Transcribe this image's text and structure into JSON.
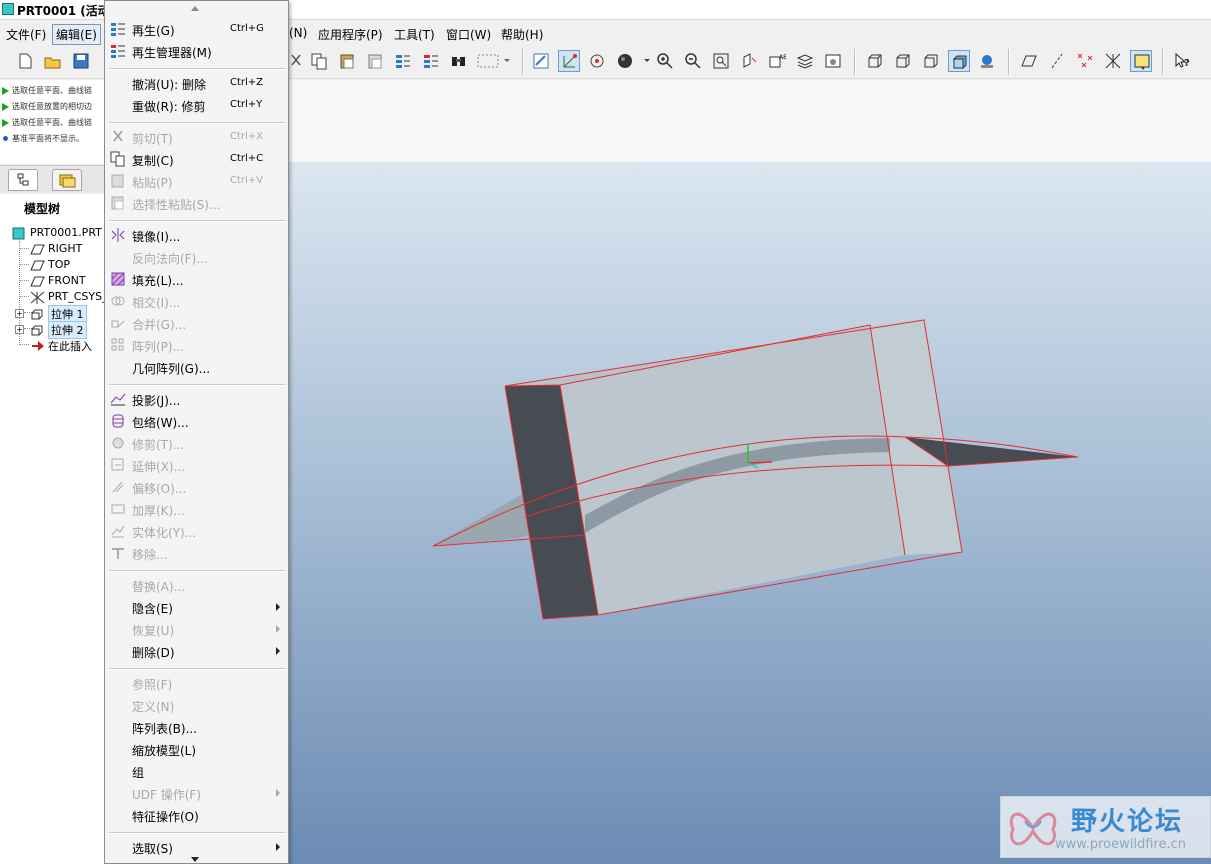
{
  "window": {
    "title": "PRT0001 (活动"
  },
  "menubar": {
    "items": [
      {
        "label": "文件(F)",
        "id": "file"
      },
      {
        "label": "编辑(E)",
        "id": "edit",
        "active": true
      },
      {
        "label": "(N)",
        "id": "insert"
      },
      {
        "label": "应用程序(P)",
        "id": "applications"
      },
      {
        "label": "工具(T)",
        "id": "tools"
      },
      {
        "label": "窗口(W)",
        "id": "window"
      },
      {
        "label": "帮助(H)",
        "id": "help"
      }
    ]
  },
  "toolbar": {
    "buttons": [
      "new-icon",
      "open-icon",
      "save-icon",
      "cut-icon",
      "copy-icon",
      "paste-icon",
      "paste-special-icon",
      "regenerate-icon",
      "regen-manager-icon",
      "find-icon",
      "select-box-icon",
      "repaint-icon",
      "spin-center-icon",
      "orient-icon",
      "shading-icon",
      "zoom-in-icon",
      "zoom-out-icon",
      "refit-icon",
      "reorient-icon",
      "saved-views-icon",
      "layers-icon",
      "view-manager-icon",
      "wireframe-icon",
      "hidden-line-icon",
      "no-hidden-icon",
      "shaded-icon",
      "enhanced-realism-icon",
      "datum-planes-icon",
      "datum-axes-icon",
      "datum-points-icon",
      "csys-icon",
      "annotations-icon",
      "context-help-icon"
    ]
  },
  "messages": [
    {
      "type": "arrow",
      "text": "选取任意平面、曲线链"
    },
    {
      "type": "arrow",
      "text": "选取任意放置的相切边"
    },
    {
      "type": "arrow",
      "text": "选取任意平面、曲线链"
    },
    {
      "type": "info",
      "text": "基准平面将不显示。"
    }
  ],
  "model_tree": {
    "header": "模型树",
    "root": "PRT0001.PRT",
    "items": [
      {
        "label": "RIGHT",
        "icon": "datum-plane-icon"
      },
      {
        "label": "TOP",
        "icon": "datum-plane-icon"
      },
      {
        "label": "FRONT",
        "icon": "datum-plane-icon"
      },
      {
        "label": "PRT_CSYS_",
        "icon": "csys-icon"
      },
      {
        "label": "拉伸 1",
        "icon": "extrude-icon",
        "expandable": true,
        "highlight": true
      },
      {
        "label": "拉伸 2",
        "icon": "extrude-icon",
        "expandable": true,
        "highlight": true
      },
      {
        "label": "在此插入",
        "icon": "insert-here-icon"
      }
    ]
  },
  "edit_menu": {
    "items": [
      {
        "label": "再生(G)",
        "shortcut": "Ctrl+G",
        "enabled": true,
        "icon": "regenerate-icon"
      },
      {
        "label": "再生管理器(M)",
        "shortcut": "",
        "enabled": true,
        "icon": "regen-manager-icon"
      },
      {
        "sep": true
      },
      {
        "label": "撤消(U): 删除",
        "shortcut": "Ctrl+Z",
        "enabled": true
      },
      {
        "label": "重做(R): 修剪",
        "shortcut": "Ctrl+Y",
        "enabled": true
      },
      {
        "sep": true
      },
      {
        "label": "剪切(T)",
        "shortcut": "Ctrl+X",
        "enabled": false,
        "icon": "cut-icon"
      },
      {
        "label": "复制(C)",
        "shortcut": "Ctrl+C",
        "enabled": true,
        "icon": "copy-icon"
      },
      {
        "label": "粘贴(P)",
        "shortcut": "Ctrl+V",
        "enabled": false,
        "icon": "paste-icon"
      },
      {
        "label": "选择性粘贴(S)...",
        "shortcut": "",
        "enabled": false,
        "icon": "paste-special-icon"
      },
      {
        "sep": true
      },
      {
        "label": "镜像(I)...",
        "shortcut": "",
        "enabled": true,
        "icon": "mirror-icon"
      },
      {
        "label": "反向法向(F)...",
        "shortcut": "",
        "enabled": false
      },
      {
        "label": "填充(L)...",
        "shortcut": "",
        "enabled": true,
        "icon": "fill-icon"
      },
      {
        "label": "相交(I)...",
        "shortcut": "",
        "enabled": false,
        "icon": "intersect-icon"
      },
      {
        "label": "合并(G)...",
        "shortcut": "",
        "enabled": false,
        "icon": "merge-icon"
      },
      {
        "label": "阵列(P)...",
        "shortcut": "",
        "enabled": false,
        "icon": "pattern-icon"
      },
      {
        "label": "几何阵列(G)...",
        "shortcut": "",
        "enabled": true
      },
      {
        "sep": true
      },
      {
        "label": "投影(J)...",
        "shortcut": "",
        "enabled": true,
        "icon": "project-icon"
      },
      {
        "label": "包络(W)...",
        "shortcut": "",
        "enabled": true,
        "icon": "wrap-icon"
      },
      {
        "label": "修剪(T)...",
        "shortcut": "",
        "enabled": false,
        "icon": "trim-icon"
      },
      {
        "label": "延伸(X)...",
        "shortcut": "",
        "enabled": false,
        "icon": "extend-icon"
      },
      {
        "label": "偏移(O)...",
        "shortcut": "",
        "enabled": false,
        "icon": "offset-icon"
      },
      {
        "label": "加厚(K)...",
        "shortcut": "",
        "enabled": false,
        "icon": "thicken-icon"
      },
      {
        "label": "实体化(Y)...",
        "shortcut": "",
        "enabled": false,
        "icon": "solidify-icon"
      },
      {
        "label": "移除...",
        "shortcut": "",
        "enabled": false,
        "icon": "remove-icon"
      },
      {
        "sep": true
      },
      {
        "label": "替换(A)...",
        "shortcut": "",
        "enabled": false
      },
      {
        "label": "隐含(E)",
        "shortcut": "",
        "enabled": true,
        "submenu": true
      },
      {
        "label": "恢复(U)",
        "shortcut": "",
        "enabled": false,
        "submenu": true
      },
      {
        "label": "删除(D)",
        "shortcut": "",
        "enabled": true,
        "submenu": true
      },
      {
        "sep": true
      },
      {
        "label": "参照(F)",
        "shortcut": "",
        "enabled": false
      },
      {
        "label": "定义(N)",
        "shortcut": "",
        "enabled": false
      },
      {
        "label": "阵列表(B)...",
        "shortcut": "",
        "enabled": true
      },
      {
        "label": "缩放模型(L)",
        "shortcut": "",
        "enabled": true
      },
      {
        "label": "组",
        "shortcut": "",
        "enabled": true
      },
      {
        "label": "UDF 操作(F)",
        "shortcut": "",
        "enabled": false,
        "submenu": true
      },
      {
        "label": "特征操作(O)",
        "shortcut": "",
        "enabled": true
      },
      {
        "sep": true
      },
      {
        "label": "选取(S)",
        "shortcut": "",
        "enabled": true,
        "submenu": true
      }
    ]
  },
  "watermark": {
    "title": "野火论坛",
    "url": "www.proewildfire.cn"
  },
  "colors": {
    "edge": "#e03030",
    "face_light": "#b7c2cb",
    "face_dark": "#474b52",
    "accent": "#3a8ad0"
  }
}
